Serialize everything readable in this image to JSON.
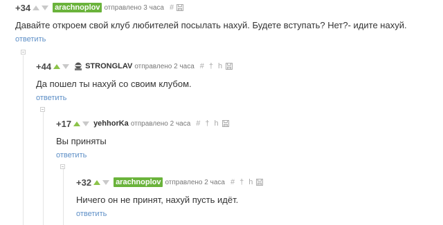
{
  "comments": [
    {
      "rating": "+34",
      "author": "arachnoplov",
      "time": "отправлено 3 часа",
      "text": "Давайте откроем свой клуб любителей посылать нахуй. Будете вступать? Нет?- идите нахуй.",
      "reply": "ответить"
    },
    {
      "rating": "+44",
      "author": "STRONGLAV",
      "time": "отправлено 2 часа",
      "text": "Да пошел ты нахуй со своим клубом.",
      "reply": "ответить"
    },
    {
      "rating": "+17",
      "author": "yehhorKa",
      "time": "отправлено 2 часа",
      "text": "Вы приняты",
      "reply": "ответить"
    },
    {
      "rating": "+32",
      "author": "arachnoplov",
      "time": "отправлено 2 часа",
      "text": "Ничего он не принят, нахуй пусть идёт.",
      "reply": "ответить"
    }
  ],
  "icons": {
    "link": "hash-icon",
    "save": "floppy-icon",
    "parent": "arrow-up-icon",
    "thread": "thread-icon"
  },
  "colors": {
    "op_badge": "#6ab33b",
    "vote_up_active": "#8cc34a",
    "reply_link": "#5c8ec6"
  }
}
